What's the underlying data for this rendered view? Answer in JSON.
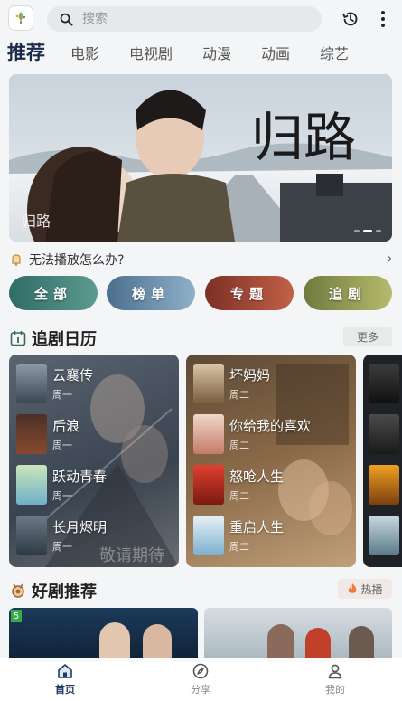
{
  "search": {
    "placeholder": "搜索"
  },
  "tabs": [
    {
      "label": "推荐",
      "active": true
    },
    {
      "label": "电影"
    },
    {
      "label": "电视剧"
    },
    {
      "label": "动漫"
    },
    {
      "label": "动画"
    },
    {
      "label": "综艺"
    }
  ],
  "banner": {
    "title_art": "归路",
    "caption": "归路"
  },
  "help": {
    "text": "无法播放怎么办?",
    "arrow": "›"
  },
  "categories": [
    {
      "label": "全部"
    },
    {
      "label": "榜单"
    },
    {
      "label": "专题"
    },
    {
      "label": "追剧"
    }
  ],
  "calendar": {
    "title": "追剧日历",
    "more": "更多",
    "cards": [
      {
        "items": [
          {
            "name": "云襄传",
            "day": "周一"
          },
          {
            "name": "后浪",
            "day": "周一"
          },
          {
            "name": "跃动青春",
            "day": "周一"
          },
          {
            "name": "长月烬明",
            "day": "周一"
          }
        ],
        "watermark": "敬请期待"
      },
      {
        "items": [
          {
            "name": "坏妈妈",
            "day": "周二"
          },
          {
            "name": "你给我的喜欢",
            "day": "周二"
          },
          {
            "name": "怒呛人生",
            "day": "周二"
          },
          {
            "name": "重启人生",
            "day": "周二"
          }
        ]
      }
    ]
  },
  "recommend": {
    "title": "好剧推荐",
    "hot": "热播",
    "badge": "5"
  },
  "nav": [
    {
      "label": "首页",
      "active": true
    },
    {
      "label": "分享"
    },
    {
      "label": "我的"
    }
  ],
  "colors": {
    "accent": "#1f3a66",
    "banner_sky": "#9fb2c6"
  }
}
